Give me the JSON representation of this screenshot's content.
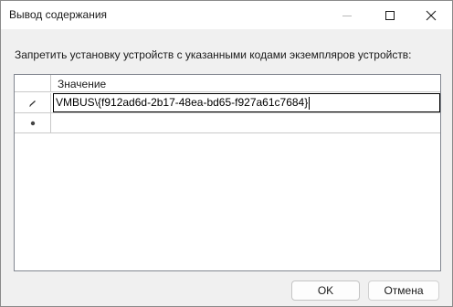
{
  "window": {
    "title": "Вывод содержания"
  },
  "titlebar_buttons": {
    "minimize_icon": "minimize-icon",
    "maximize_icon": "maximize-icon",
    "close_icon": "close-icon"
  },
  "instruction": "Запретить установку устройств с указанными кодами экземпляров устройств:",
  "grid": {
    "column_header": "Значение",
    "rows": [
      {
        "indicator": "edit-pencil-icon",
        "value": "VMBUS\\{f912ad6d-2b17-48ea-bd65-f927a61c7684}"
      },
      {
        "indicator": "new-row-asterisk-icon",
        "value": ""
      }
    ]
  },
  "buttons": {
    "ok_label": "OK",
    "cancel_label": "Отмена"
  }
}
